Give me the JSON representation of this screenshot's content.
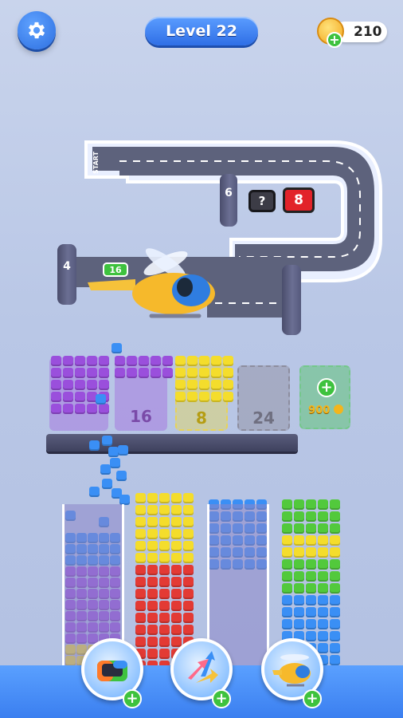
{
  "hud": {
    "level_label": "Level 22",
    "coins": "210",
    "icons": {
      "settings": "gear-icon",
      "coin": "coin-icon",
      "add": "plus-icon"
    }
  },
  "track": {
    "start_label": "START",
    "pillar_counts": [
      "6",
      "4"
    ],
    "queue_boxes": [
      "?",
      "8"
    ],
    "helicopter_label": "16"
  },
  "slots": [
    {
      "label": "",
      "color": "#9a4fdc"
    },
    {
      "label": "16",
      "color": "#9a4fdc"
    },
    {
      "label": "8",
      "color": "#f3dd2f"
    },
    {
      "label": "24",
      "color": "#9a9aa8"
    }
  ],
  "buy_slot": {
    "price": "900",
    "plus": "+"
  },
  "boosters": [
    {
      "name": "tray-booster",
      "plus": "+"
    },
    {
      "name": "shuffle-booster",
      "plus": "+"
    },
    {
      "name": "helicopter-booster",
      "plus": "+"
    }
  ],
  "colors": {
    "purple": "#9a4fdc",
    "yellow": "#f4dd2c",
    "red": "#e33a34",
    "blue": "#3a8ff5",
    "green": "#52c93c"
  }
}
